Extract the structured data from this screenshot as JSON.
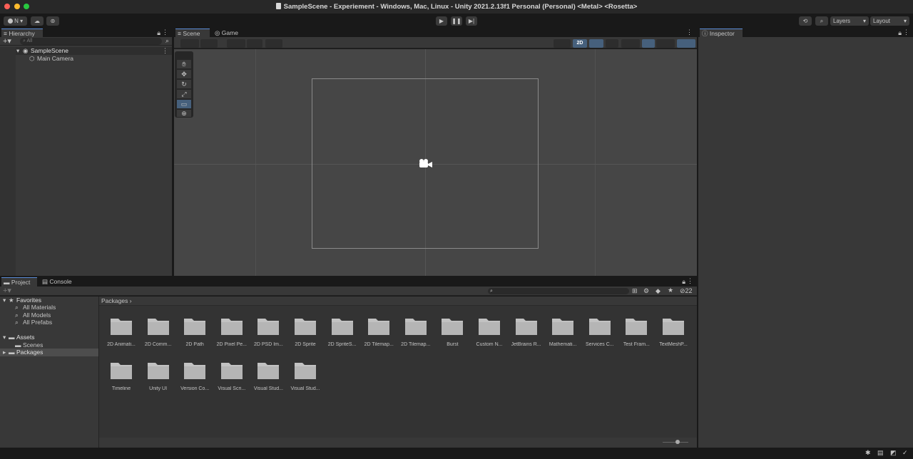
{
  "window": {
    "title": "SampleScene - Experiement - Windows, Mac, Linux - Unity 2021.2.13f1 Personal (Personal) <Metal> <Rosetta>"
  },
  "toolbar": {
    "account_label": "N",
    "layers_label": "Layers",
    "layout_label": "Layout"
  },
  "hierarchy": {
    "tab": "Hierarchy",
    "search_placeholder": "All",
    "scene": "SampleScene",
    "items": [
      "Main Camera"
    ]
  },
  "scene_view": {
    "tabs": [
      "Scene",
      "Game"
    ],
    "mode_2d": "2D"
  },
  "inspector": {
    "tab": "Inspector"
  },
  "project": {
    "tabs": [
      "Project",
      "Console"
    ],
    "hidden_count": "22",
    "breadcrumb": "Packages",
    "tree": {
      "favorites": "Favorites",
      "fav_items": [
        "All Materials",
        "All Models",
        "All Prefabs"
      ],
      "assets": "Assets",
      "asset_items": [
        "Scenes"
      ],
      "packages": "Packages"
    },
    "folders": [
      "2D Animati...",
      "2D Comm...",
      "2D Path",
      "2D Pixel Pe...",
      "2D PSD Im...",
      "2D Sprite",
      "2D SpriteS...",
      "2D Tilemap...",
      "2D Tilemap...",
      "Burst",
      "Custom N...",
      "JetBrains R...",
      "Mathemati...",
      "Services C...",
      "Test Fram...",
      "TextMeshP...",
      "Timeline",
      "Unity UI",
      "Version Co...",
      "Visual Scri...",
      "Visual Stud...",
      "Visual Stud..."
    ]
  },
  "colors": {
    "accent": "#5a8bd6",
    "panel": "#383838",
    "dark": "#282828",
    "folder": "#c2c2c2"
  }
}
